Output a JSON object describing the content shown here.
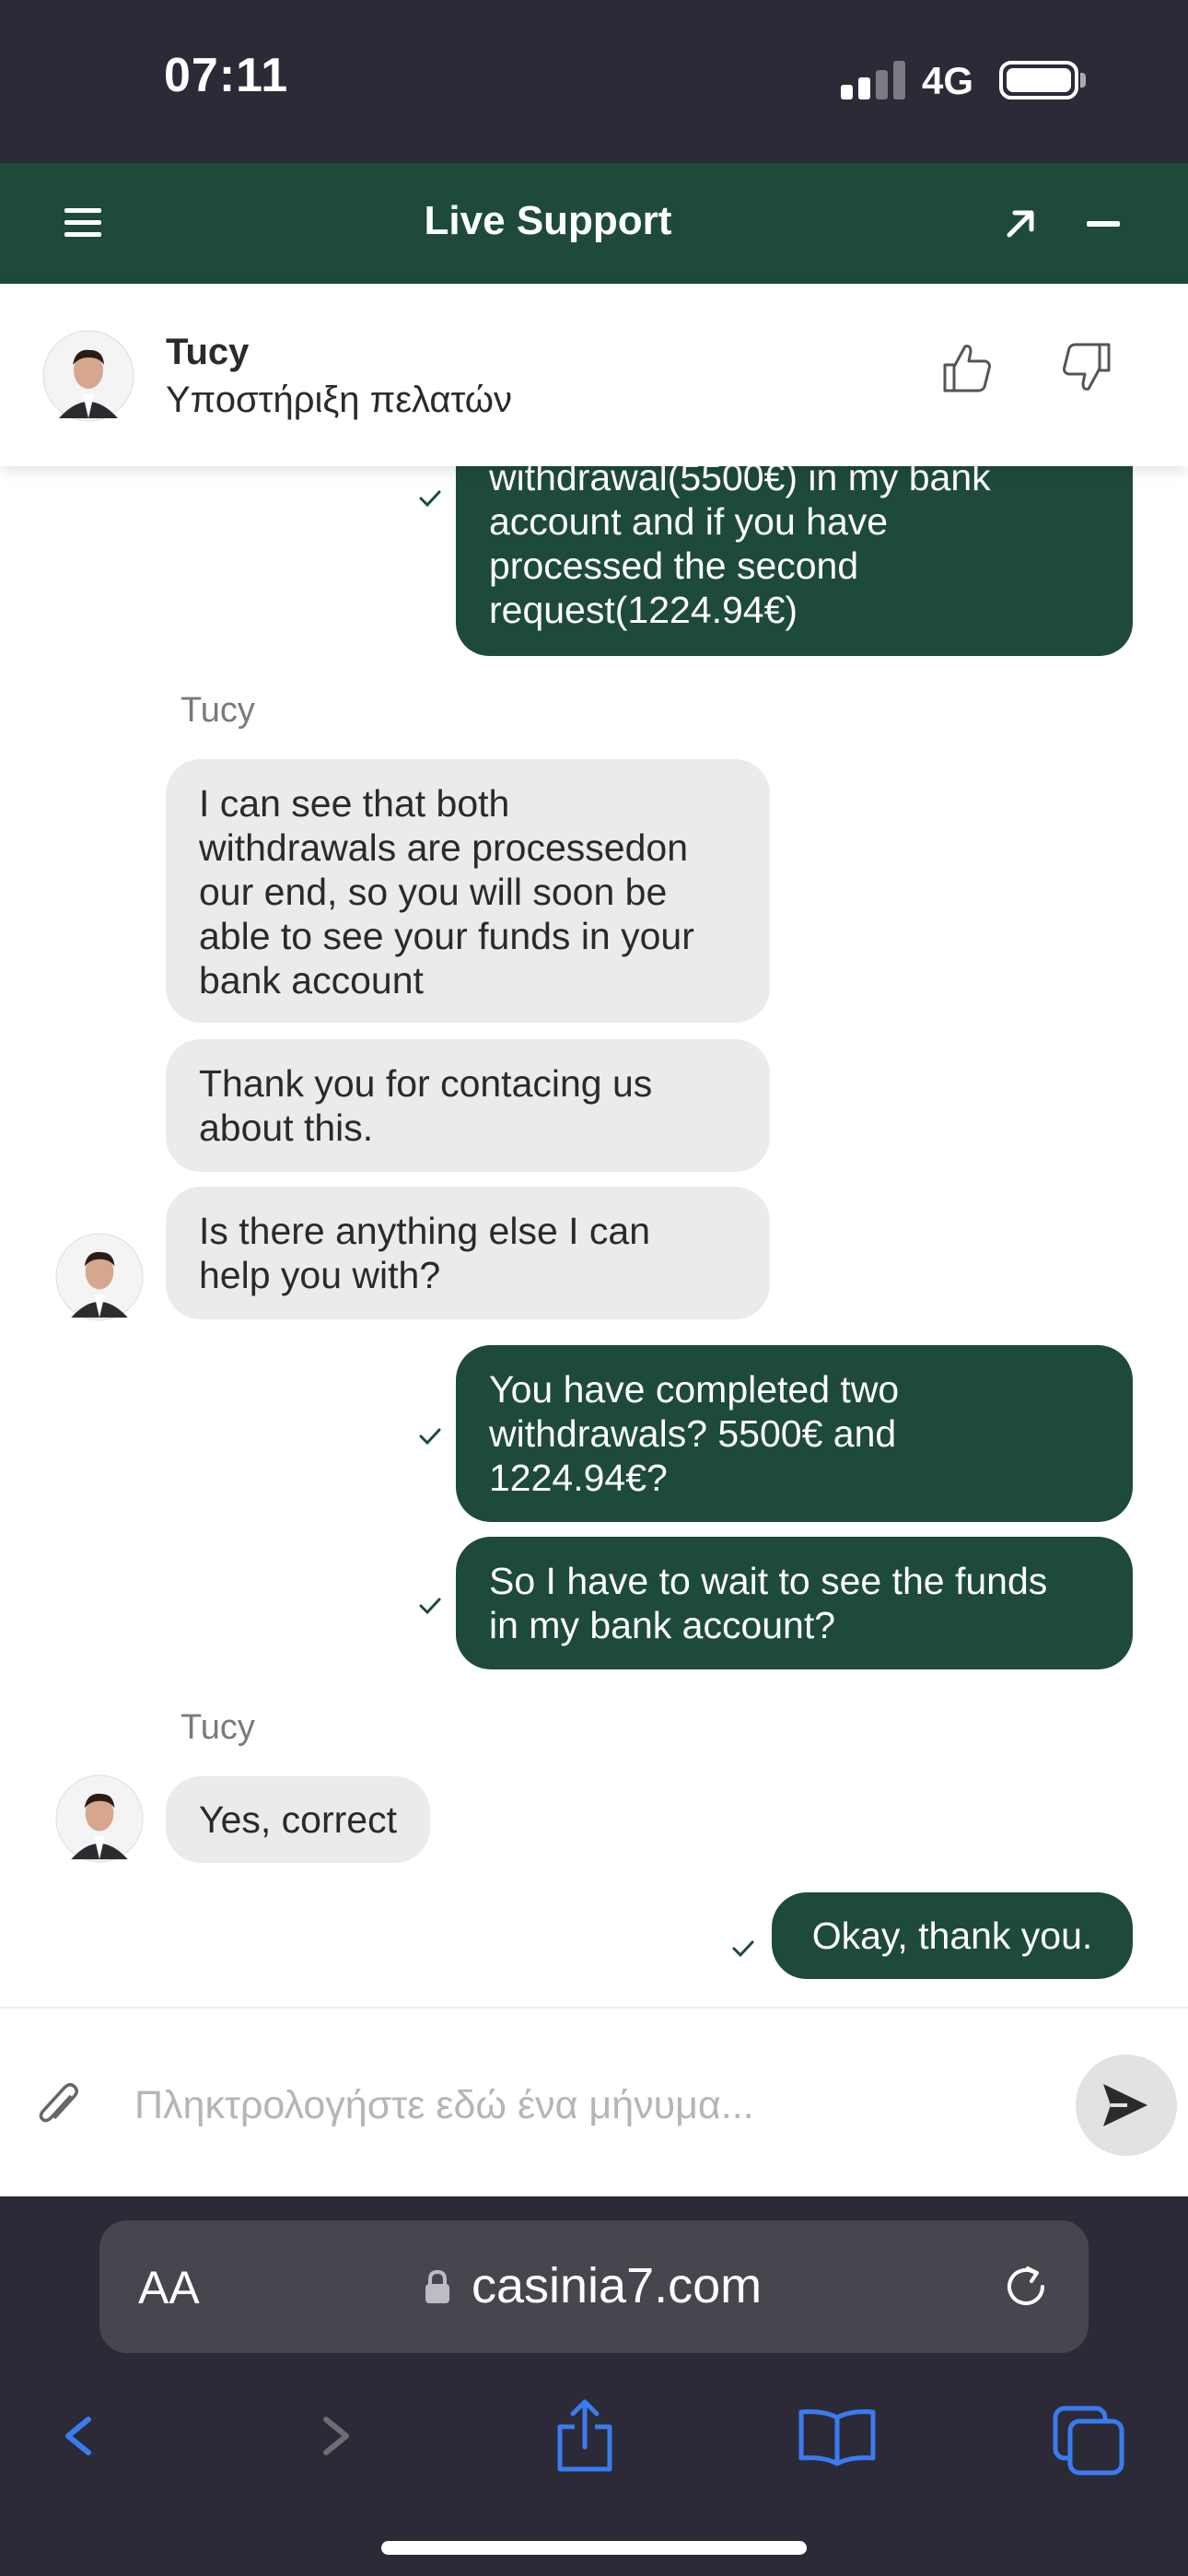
{
  "status_bar": {
    "time": "07:11",
    "network": "4G"
  },
  "header": {
    "title": "Live Support"
  },
  "agent": {
    "name": "Tucy",
    "role": "Υποστήριξη πελατών"
  },
  "chat": {
    "out_1": [
      "withdrawal(5500€) in my bank",
      "account and if you have",
      "processed the second",
      "request(1224.94€)"
    ],
    "sender_1": "Tucy",
    "in_1": [
      "I can see that both",
      "withdrawals are processedon",
      "our end, so you will soon be",
      "able to see your funds in your",
      "bank account"
    ],
    "in_2": [
      "Thank you for contacing us",
      "about this."
    ],
    "in_3": [
      "Is there anything else I can",
      "help you with?"
    ],
    "out_2": [
      "You have completed two",
      "withdrawals? 5500€ and",
      "1224.94€?"
    ],
    "out_3": [
      "So I have to wait to see the funds",
      "in my bank account?"
    ],
    "sender_2": "Tucy",
    "in_4": "Yes, correct",
    "out_4": "Okay, thank you."
  },
  "composer": {
    "placeholder": "Πληκτρολογήστε εδώ ένα μήνυμα..."
  },
  "browser": {
    "aa_label": "AA",
    "url": "casinia7.com"
  },
  "colors": {
    "brand_green": "#1e4a3a",
    "incoming_bubble": "#ebebed",
    "system_bg": "#2c2a36",
    "ios_blue": "#3a7cf0"
  }
}
